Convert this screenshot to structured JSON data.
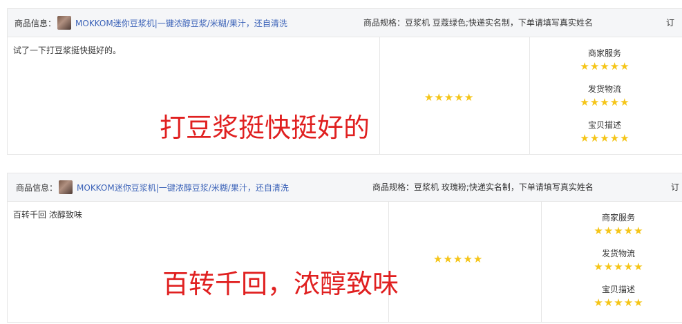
{
  "reviews": [
    {
      "info_label": "商品信息：",
      "product_title": "MOKKOM迷你豆浆机|一键浓醇豆浆/米糊/果汁，还自清洗",
      "spec": "商品规格：豆浆机 豆蔻绿色;快递实名制，下单请填写真实姓名",
      "order_truncated": "订",
      "review_text": "试了一下打豆浆挺快挺好的。",
      "overlay_text": "打豆浆挺快挺好的",
      "overall_stars": 5,
      "ratings": [
        {
          "label": "商家服务",
          "stars": 5
        },
        {
          "label": "发货物流",
          "stars": 5
        },
        {
          "label": "宝贝描述",
          "stars": 5
        }
      ]
    },
    {
      "info_label": "商品信息：",
      "product_title": "MOKKOM迷你豆浆机|一键浓醇豆浆/米糊/果汁，还自清洗",
      "spec": "商品规格：豆浆机 玫瑰粉;快递实名制，下单请填写真实姓名",
      "order_truncated": "订",
      "review_text": "百转千回 浓醇致味",
      "overlay_text": "百转千回，浓醇致味",
      "overall_stars": 5,
      "ratings": [
        {
          "label": "商家服务",
          "stars": 5
        },
        {
          "label": "发货物流",
          "stars": 5
        },
        {
          "label": "宝贝描述",
          "stars": 5
        }
      ]
    }
  ],
  "colors": {
    "star": "#f5c518",
    "overlay": "#e02020",
    "link": "#3c63b8"
  },
  "icons": {
    "star": "star-icon",
    "thumb": "product-thumbnail"
  }
}
